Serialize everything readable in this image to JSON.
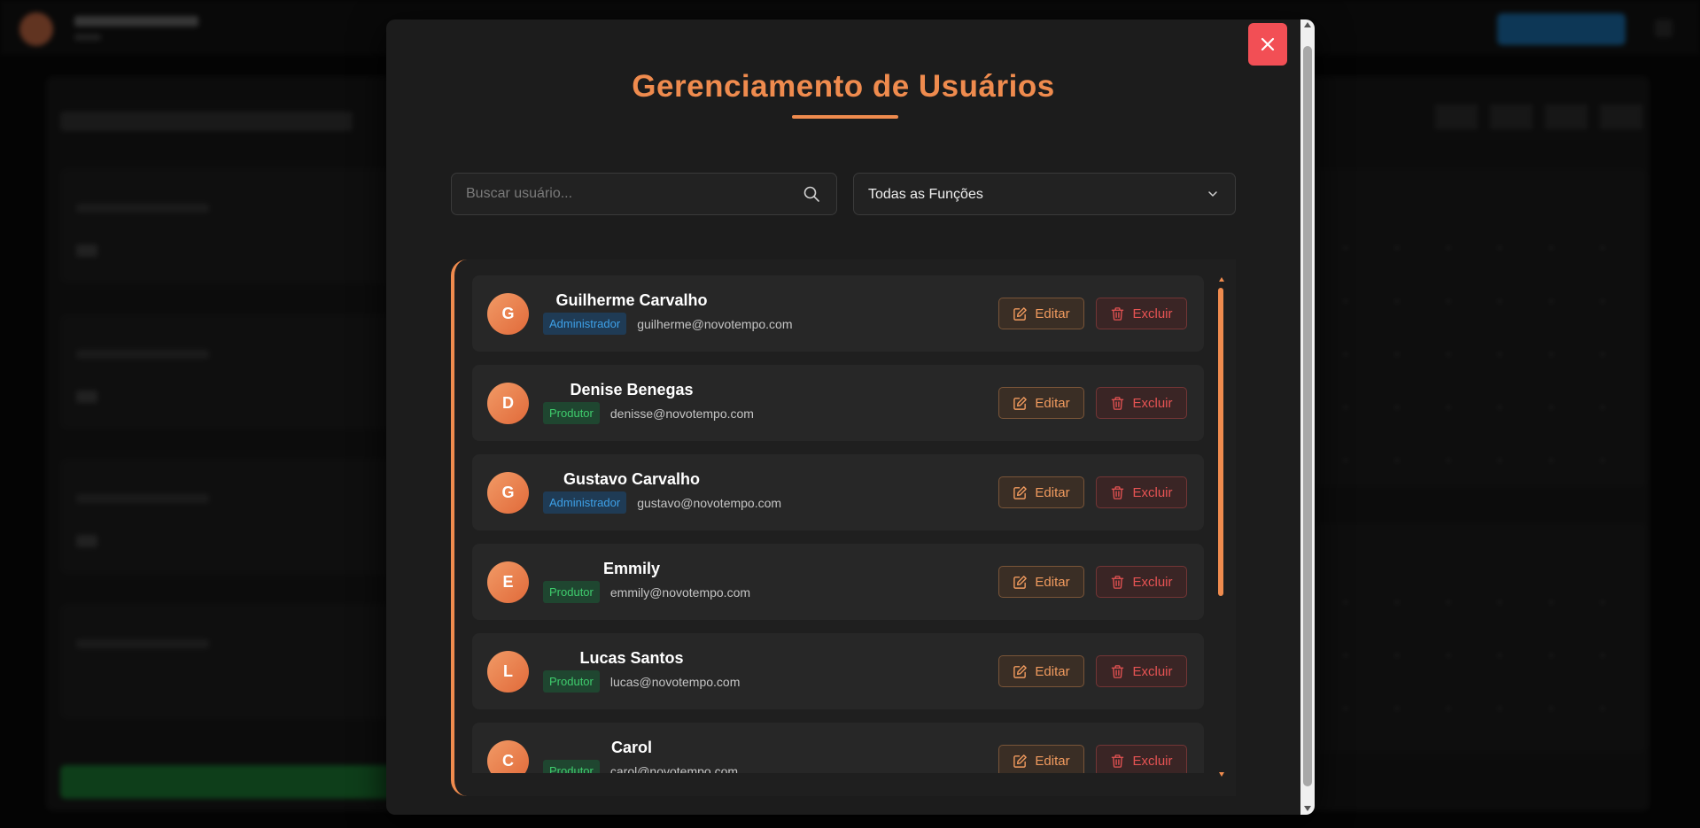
{
  "modal": {
    "title": "Gerenciamento de Usuários",
    "search_placeholder": "Buscar usuário...",
    "role_filter_selected": "Todas as Funções",
    "edit_label": "Editar",
    "delete_label": "Excluir"
  },
  "users": [
    {
      "initial": "G",
      "name": "Guilherme Carvalho",
      "role": "Administrador",
      "email": "guilherme@novotempo.com"
    },
    {
      "initial": "D",
      "name": "Denise Benegas",
      "role": "Produtor",
      "email": "denisse@novotempo.com"
    },
    {
      "initial": "G",
      "name": "Gustavo Carvalho",
      "role": "Administrador",
      "email": "gustavo@novotempo.com"
    },
    {
      "initial": "E",
      "name": "Emmily",
      "role": "Produtor",
      "email": "emmily@novotempo.com"
    },
    {
      "initial": "L",
      "name": "Lucas Santos",
      "role": "Produtor",
      "email": "lucas@novotempo.com"
    },
    {
      "initial": "C",
      "name": "Carol",
      "role": "Produtor",
      "email": "carol@novotempo.com"
    }
  ],
  "colors": {
    "accent": "#ef8b4e",
    "close": "#f24f55",
    "admin_badge": "#3ea1e8",
    "producer_badge": "#3fcd6d",
    "delete": "#e65353"
  }
}
